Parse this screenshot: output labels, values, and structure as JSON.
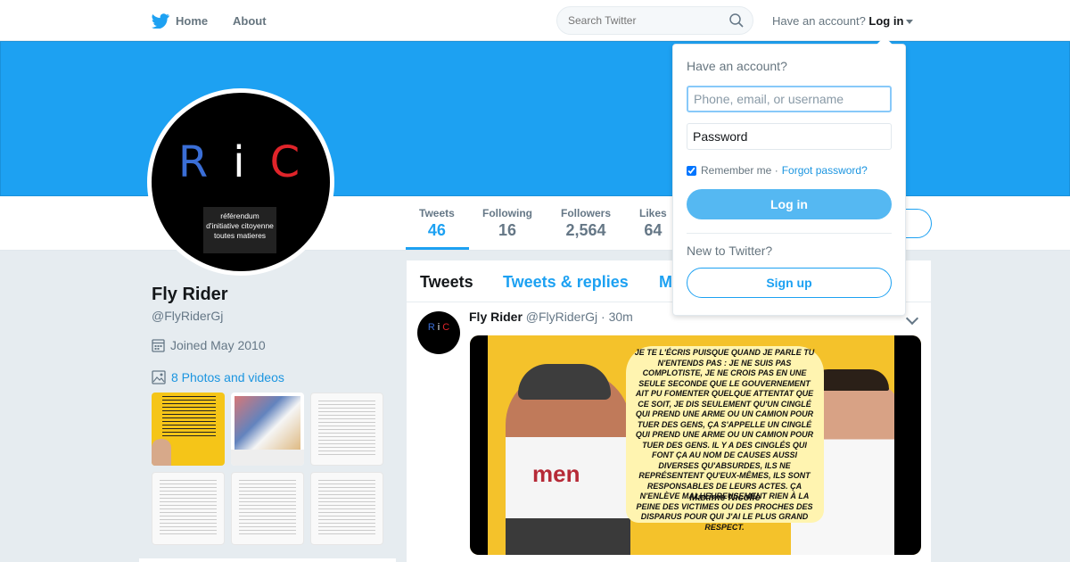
{
  "nav": {
    "home_label": "Home",
    "about_label": "About",
    "search_placeholder": "Search Twitter",
    "have_account": "Have an account?",
    "login_label": "Log in"
  },
  "colors": {
    "accent": "#1da1f2",
    "banner": "#1da1f2",
    "login_button": "#55b8f2"
  },
  "icons": {
    "brand": "twitter-bird-icon",
    "search": "magnifier-icon",
    "calendar": "calendar-icon",
    "photos": "image-icon",
    "caret": "chevron-down-icon"
  },
  "profile": {
    "name": "Fly Rider",
    "handle": "@FlyRiderGj",
    "joined": "Joined May 2010",
    "photos_link": "8 Photos and videos",
    "avatar_letters": [
      "R",
      "i",
      "C"
    ],
    "avatar_caption": "référendum d'initiative citoyenne toutes matieres",
    "stats": [
      {
        "label": "Tweets",
        "value": "46"
      },
      {
        "label": "Following",
        "value": "16"
      },
      {
        "label": "Followers",
        "value": "2,564"
      },
      {
        "label": "Likes",
        "value": "64"
      }
    ]
  },
  "timeline": {
    "tabs": [
      "Tweets",
      "Tweets & replies",
      "M"
    ],
    "tweet": {
      "name": "Fly Rider",
      "handle": "@FlyRiderGj",
      "time": "· 30m",
      "avatar_letters": [
        "R",
        "i",
        "C"
      ],
      "image_quote": "Je te l'écris puisque quand je parle tu n'entends pas : je ne suis pas complotiste, je ne crois pas en une seule seconde que le gouvernement ait pu fomenter quelque attentat que ce soit, je dis seulement qu'un cinglé qui prend une arme ou un camion pour tuer des gens, ça s'appelle un cinglé qui prend une arme ou un camion pour tuer des gens. Il y a des cinglés qui font ça au nom de causes aussi diverses qu'absurdes, ils ne représentent qu'eux-mêmes, ils sont responsables de leurs actes. Ça n'enlève malheureusement rien à la peine des victimes ou des proches des disparus pour qui j'ai le plus grand respect.",
      "image_author": "Maxime Nicolle",
      "image_shirt_text": "men"
    }
  },
  "login_dropdown": {
    "title": "Have an account?",
    "phone_placeholder": "Phone, email, or username",
    "password_placeholder": "Password",
    "remember_label": "Remember me",
    "remember_checked": true,
    "separator": "·",
    "forgot_label": "Forgot password?",
    "login_button": "Log in",
    "new_prompt": "New to Twitter?",
    "signup_button": "Sign up"
  }
}
